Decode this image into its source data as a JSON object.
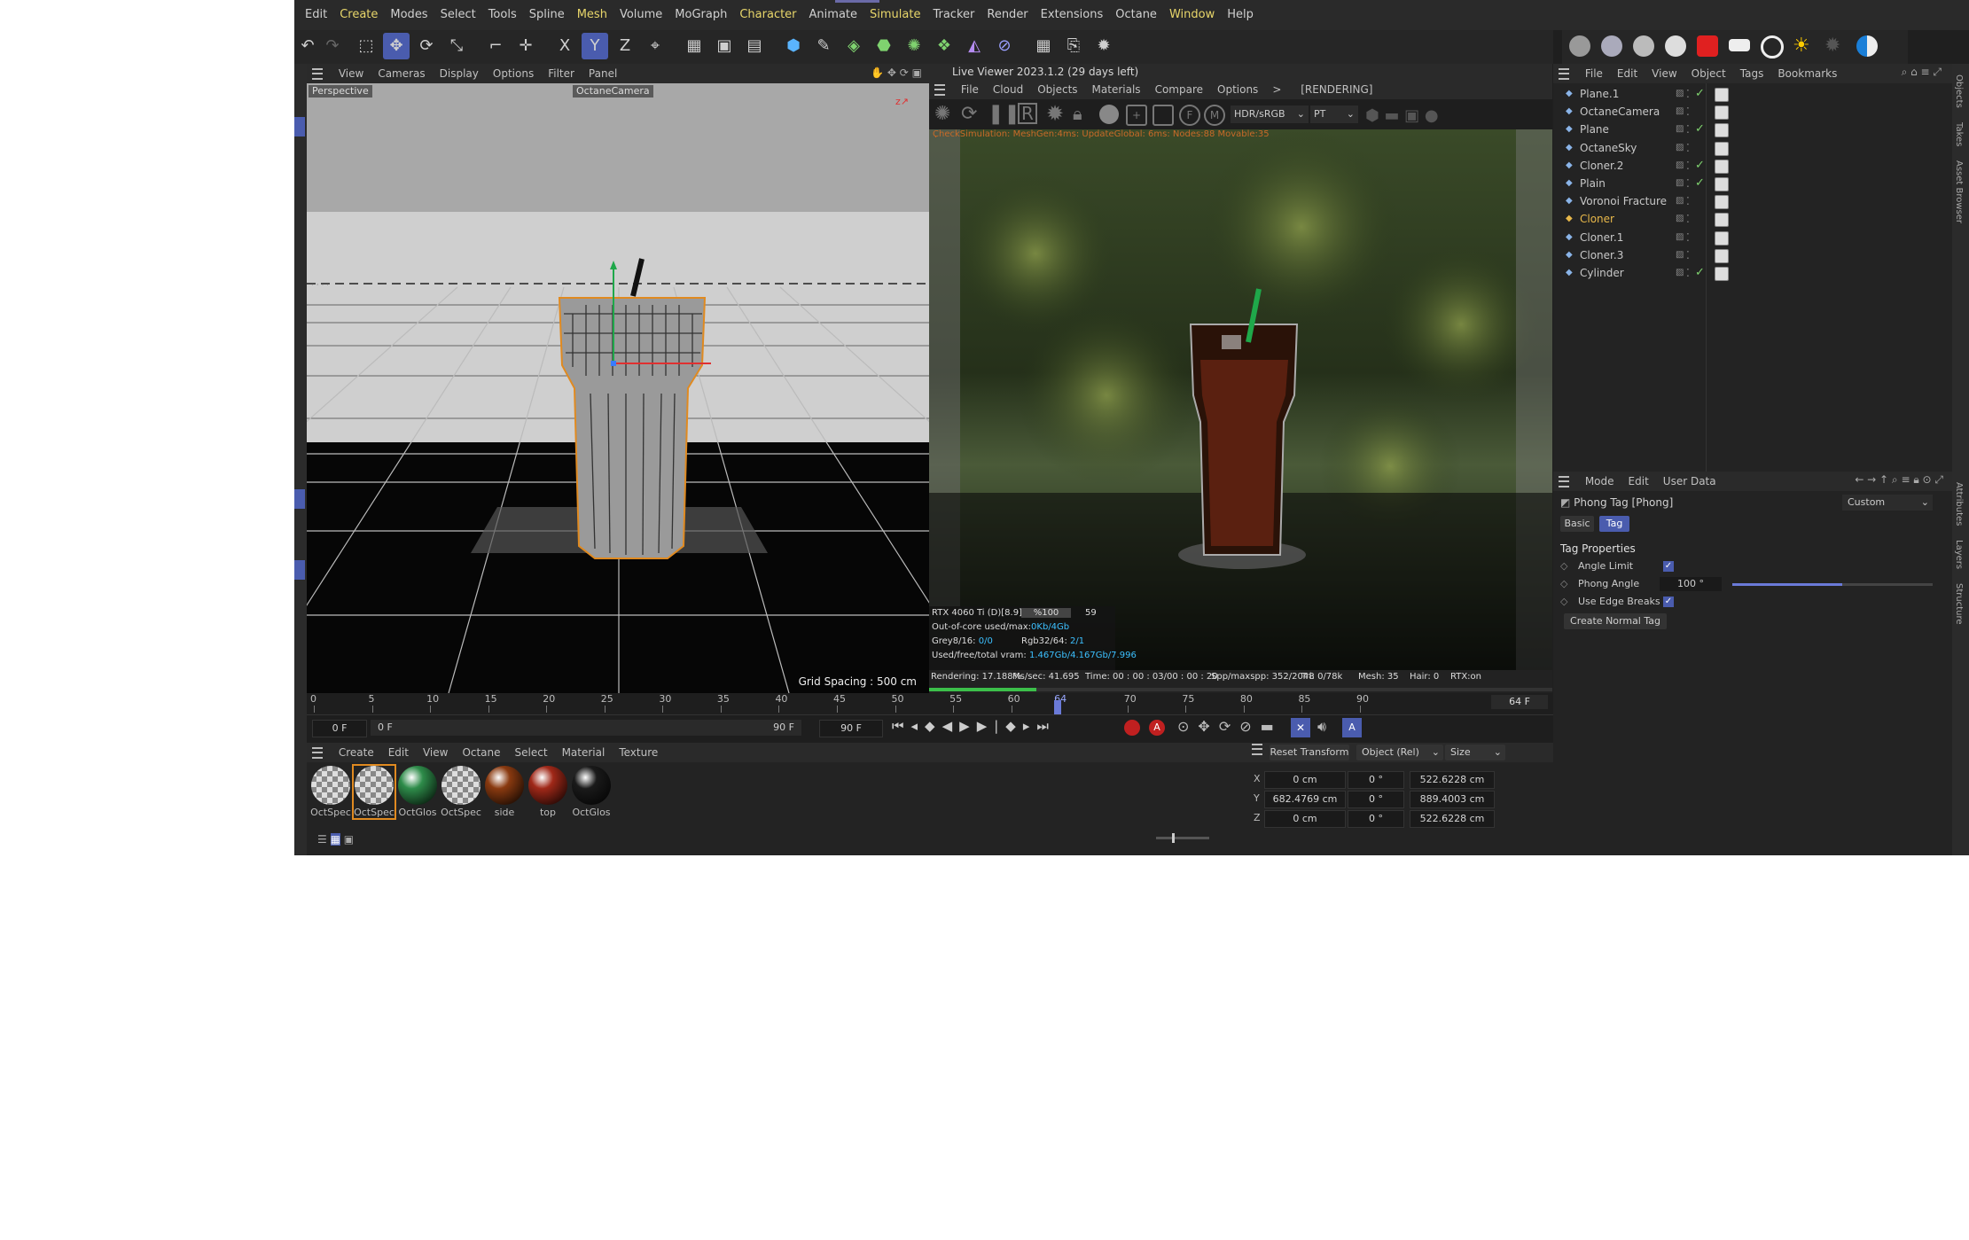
{
  "menu": [
    "Edit",
    "Create",
    "Modes",
    "Select",
    "Tools",
    "Spline",
    "Mesh",
    "Volume",
    "MoGraph",
    "Character",
    "Animate",
    "Simulate",
    "Tracker",
    "Render",
    "Extensions",
    "Octane",
    "Window",
    "Help"
  ],
  "menu_highlight": [
    "Create",
    "Mesh",
    "Character",
    "Simulate",
    "Window"
  ],
  "viewport": {
    "menu": [
      "View",
      "Cameras",
      "Display",
      "Options",
      "Filter",
      "Panel"
    ],
    "label": "Perspective",
    "camera": "OctaneCamera",
    "grid_spacing": "Grid Spacing : 500 cm"
  },
  "live_viewer": {
    "title": "Live Viewer 2023.1.2 (29 days left)",
    "menu": [
      "File",
      "Cloud",
      "Objects",
      "Materials",
      "Compare",
      "Options",
      ">"
    ],
    "status": "[RENDERING]",
    "colorspace": "HDR/sRGB",
    "kernel": "PT",
    "overlay_text": "CheckSimulation: MeshGen:4ms: UpdateGlobal: 6ms: Nodes:88 Movable:35",
    "gpu": "RTX 4060 Ti (D)[8.9]",
    "gpu_pct": "%100",
    "gpu_temp": "59",
    "out_of_core": "Out-of-core used/max:",
    "out_of_core_val": "0Kb/4Gb",
    "grey": "Grey8/16:",
    "grey_val": "0/0",
    "rgb": "Rgb32/64:",
    "rgb_val": "2/1",
    "vram": "Used/free/total vram:",
    "vram_val": "1.467Gb/4.167Gb/7.996",
    "progress": 0.17188,
    "footer": {
      "rendering": "Rendering: 17.188%",
      "ms": "Ms/sec: 41.695",
      "time": "Time: 00 : 00 : 03/00 : 00 : 20",
      "spp": "Spp/maxspp: 352/2048",
      "tri": "Tri: 0/78k",
      "mesh": "Mesh: 35",
      "hair": "Hair: 0",
      "rtx": "RTX:on"
    }
  },
  "objects_panel": {
    "menu": [
      "File",
      "Edit",
      "View",
      "Object",
      "Tags",
      "Bookmarks"
    ],
    "items": [
      {
        "name": "Plane.1",
        "icon": "plane-icon",
        "check": true
      },
      {
        "name": "OctaneCamera",
        "icon": "camera-icon",
        "check": false
      },
      {
        "name": "Plane",
        "icon": "plane-icon",
        "check": true
      },
      {
        "name": "OctaneSky",
        "icon": "sky-icon",
        "check": false
      },
      {
        "name": "Cloner.2",
        "icon": "cloner-icon",
        "check": true
      },
      {
        "name": "Plain",
        "icon": "effector-icon",
        "check": true
      },
      {
        "name": "Voronoi Fracture",
        "icon": "voronoi-icon",
        "check": false
      },
      {
        "name": "Cloner",
        "icon": "cloner-icon",
        "check": false,
        "selected": true
      },
      {
        "name": "Cloner.1",
        "icon": "cloner-icon",
        "check": false
      },
      {
        "name": "Cloner.3",
        "icon": "cloner-icon",
        "check": false
      },
      {
        "name": "Cylinder",
        "icon": "cylinder-icon",
        "check": true
      }
    ],
    "side_tabs": [
      "Objects",
      "Takes",
      "Asset Browser"
    ]
  },
  "attributes": {
    "menu": [
      "Mode",
      "Edit",
      "User Data"
    ],
    "title": "Phong Tag [Phong]",
    "preset": "Custom",
    "tabs": [
      "Basic",
      "Tag"
    ],
    "section": "Tag Properties",
    "angle_limit_label": "Angle Limit",
    "phong_angle_label": "Phong Angle",
    "phong_angle_value": "100 °",
    "phong_angle_fraction": 0.55,
    "edge_breaks_label": "Use Edge Breaks",
    "create_normal_tag": "Create Normal Tag",
    "side_tabs": [
      "Attributes",
      "Layers",
      "Structure"
    ]
  },
  "timeline": {
    "ticks": [
      "0",
      "5",
      "10",
      "15",
      "20",
      "25",
      "30",
      "35",
      "40",
      "45",
      "50",
      "55",
      "60",
      "64",
      "70",
      "75",
      "80",
      "85",
      "90"
    ],
    "current_frame": "64 F",
    "current_fraction": 0.711,
    "start": "0 F",
    "min": "0 F",
    "max_label": "90 F",
    "end": "90 F"
  },
  "materials": {
    "menu": [
      "Create",
      "Edit",
      "View",
      "Octane",
      "Select",
      "Material",
      "Texture"
    ],
    "items": [
      {
        "name": "OctSpec",
        "color": "checker"
      },
      {
        "name": "OctSpec",
        "color": "checker",
        "selected": true
      },
      {
        "name": "OctGlos",
        "color": "#2e8c4a"
      },
      {
        "name": "OctSpec",
        "color": "checker"
      },
      {
        "name": "side",
        "color": "#8a3a10"
      },
      {
        "name": "top",
        "color": "#a02818"
      },
      {
        "name": "OctGlos",
        "color": "#1a1a1a"
      }
    ]
  },
  "coords": {
    "reset": "Reset Transform",
    "mode": "Object (Rel)",
    "size_mode": "Size",
    "rows": [
      {
        "axis": "X",
        "pos": "0 cm",
        "rot": "0 °",
        "size": "522.6228 cm"
      },
      {
        "axis": "Y",
        "pos": "682.4769 cm",
        "rot": "0 °",
        "size": "889.4003 cm"
      },
      {
        "axis": "Z",
        "pos": "0 cm",
        "rot": "0 °",
        "size": "522.6228 cm"
      }
    ]
  },
  "colors": {
    "accent": "#4a5cae",
    "highlight": "#e8d66a",
    "selected": "#e8b84a",
    "progress": "#3cc04a"
  }
}
